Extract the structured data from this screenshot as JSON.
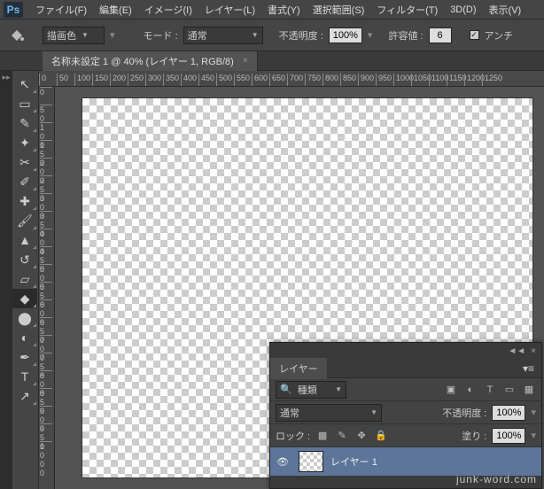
{
  "app": {
    "logo": "Ps"
  },
  "menu": [
    "ファイル(F)",
    "編集(E)",
    "イメージ(I)",
    "レイヤー(L)",
    "書式(Y)",
    "選択範囲(S)",
    "フィルター(T)",
    "3D(D)",
    "表示(V)"
  ],
  "optbar": {
    "fill_mode": "描画色",
    "mode_label": "モード :",
    "mode_value": "通常",
    "opacity_label": "不透明度 :",
    "opacity_value": "100%",
    "tolerance_label": "許容値 :",
    "tolerance_value": "6",
    "antialias_label": "アンチ"
  },
  "doc_tab": {
    "title": "名称未設定 1 @ 40% (レイヤー 1, RGB/8)"
  },
  "ruler_h": [
    "0",
    "50",
    "100",
    "150",
    "200",
    "250",
    "300",
    "350",
    "400",
    "450",
    "500",
    "550",
    "600",
    "650",
    "700",
    "750",
    "800",
    "850",
    "900",
    "950",
    "1000",
    "1050",
    "1100",
    "1150",
    "1200",
    "1250"
  ],
  "ruler_v": [
    "0",
    "50",
    "100",
    "150",
    "200",
    "250",
    "300",
    "350",
    "400",
    "450",
    "500",
    "550",
    "600",
    "650",
    "700",
    "750",
    "800",
    "850",
    "900",
    "950",
    "1000"
  ],
  "tools": [
    {
      "name": "move-tool",
      "glyph": "↖"
    },
    {
      "name": "marquee-tool",
      "glyph": "▭"
    },
    {
      "name": "lasso-tool",
      "glyph": "✎"
    },
    {
      "name": "wand-tool",
      "glyph": "✦"
    },
    {
      "name": "crop-tool",
      "glyph": "✂"
    },
    {
      "name": "eyedropper-tool",
      "glyph": "✐"
    },
    {
      "name": "heal-tool",
      "glyph": "✚"
    },
    {
      "name": "brush-tool",
      "glyph": "🖌"
    },
    {
      "name": "stamp-tool",
      "glyph": "▲"
    },
    {
      "name": "history-tool",
      "glyph": "↺"
    },
    {
      "name": "eraser-tool",
      "glyph": "▱"
    },
    {
      "name": "bucket-tool",
      "glyph": "◆",
      "sel": true
    },
    {
      "name": "blur-tool",
      "glyph": "⬤"
    },
    {
      "name": "dodge-tool",
      "glyph": "◐"
    },
    {
      "name": "pen-tool",
      "glyph": "✒"
    },
    {
      "name": "type-tool",
      "glyph": "T"
    },
    {
      "name": "path-tool",
      "glyph": "↗"
    }
  ],
  "layers_panel": {
    "title": "レイヤー",
    "filter_label": "種類",
    "blend_mode": "通常",
    "opacity_label": "不透明度 :",
    "opacity_value": "100%",
    "lock_label": "ロック :",
    "fill_label": "塗り :",
    "fill_value": "100%",
    "layer_name": "レイヤー 1",
    "search_icon": "🔍"
  },
  "watermark": "junk-word.com"
}
